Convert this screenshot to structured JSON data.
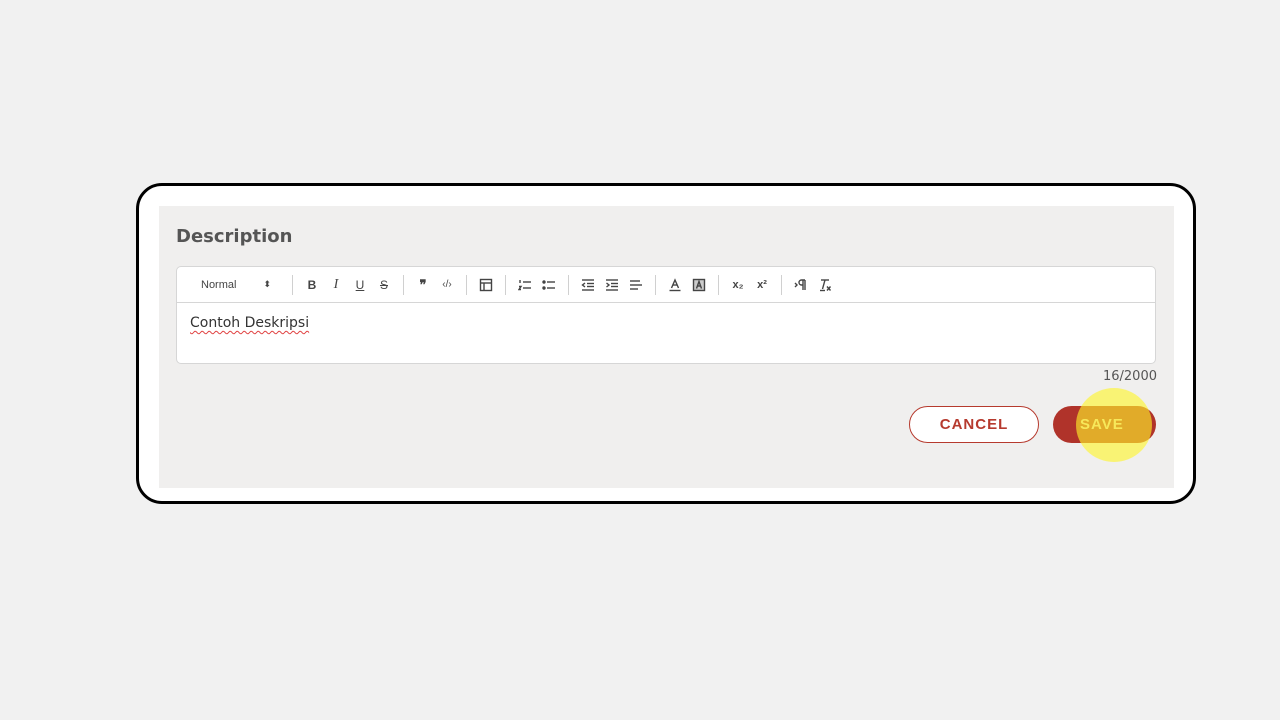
{
  "form": {
    "title": "Description",
    "toolbar": {
      "format_select": "Normal",
      "format_caret": "⬍",
      "buttons": {
        "bold": "B",
        "italic": "I",
        "underline": "U",
        "strike": "S",
        "blockquote": "❞",
        "code": "‹/›",
        "subscript": "x₂",
        "superscript": "x²"
      }
    },
    "content": "Contoh Deskripsi",
    "char_count": "16/2000",
    "cancel_label": "CANCEL",
    "save_label": "SAVE"
  },
  "colors": {
    "accent": "#b0332a",
    "highlight": "#fff528"
  }
}
